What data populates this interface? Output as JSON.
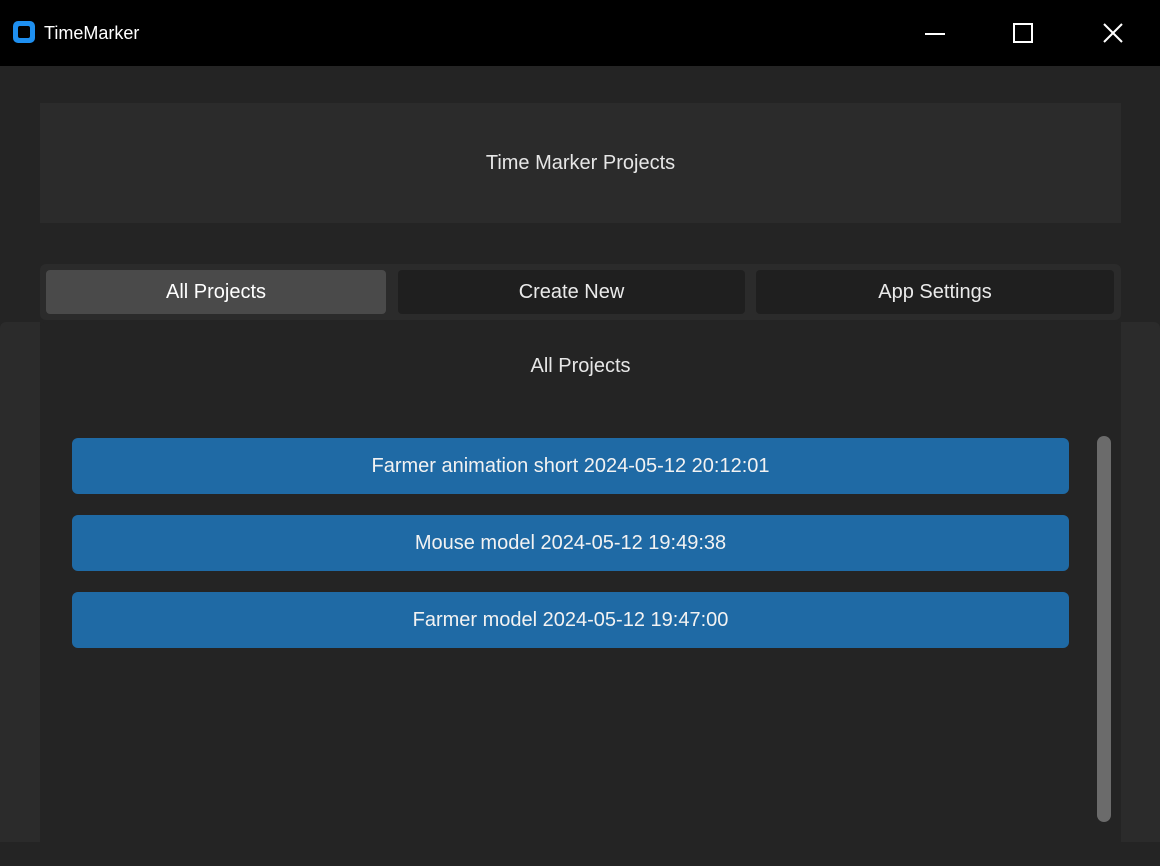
{
  "window": {
    "title": "TimeMarker",
    "controls": {
      "minimize": "minimize-icon",
      "maximize": "maximize-icon",
      "close": "close-icon"
    }
  },
  "header": {
    "title": "Time Marker Projects"
  },
  "tabs": [
    {
      "label": "All Projects",
      "active": true
    },
    {
      "label": "Create New",
      "active": false
    },
    {
      "label": "App Settings",
      "active": false
    }
  ],
  "content": {
    "title": "All Projects",
    "projects": [
      {
        "label": "Farmer animation short 2024-05-12 20:12:01"
      },
      {
        "label": "Mouse model 2024-05-12 19:49:38"
      },
      {
        "label": "Farmer model 2024-05-12 19:47:00"
      }
    ]
  },
  "colors": {
    "accent": "#1f6aa5",
    "app_icon": "#1e8ff0",
    "background": "#242424",
    "panel": "#2b2b2b",
    "active_tab": "#4a4a4a"
  }
}
